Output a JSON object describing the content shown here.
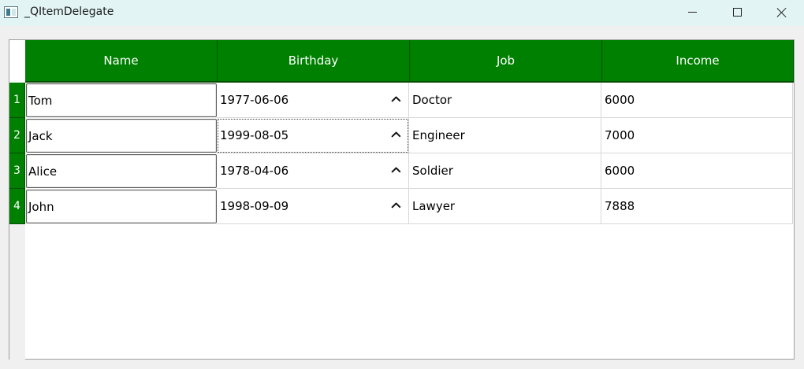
{
  "window": {
    "title": "_QItemDelegate"
  },
  "table": {
    "columns": [
      "Name",
      "Birthday",
      "Job",
      "Income"
    ],
    "row_numbers": [
      "1",
      "2",
      "3",
      "4"
    ],
    "rows": [
      {
        "name": "Tom",
        "birthday": "1977-06-06",
        "job": "Doctor",
        "income": "6000"
      },
      {
        "name": "Jack",
        "birthday": "1999-08-05",
        "job": "Engineer",
        "income": "7000"
      },
      {
        "name": "Alice",
        "birthday": "1978-04-06",
        "job": "Soldier",
        "income": "6000"
      },
      {
        "name": "John",
        "birthday": "1998-09-09",
        "job": "Lawyer",
        "income": "7888"
      }
    ]
  },
  "colors": {
    "header_bg": "#008000",
    "header_text": "#ffffff",
    "titlebar_bg": "#e3f4f4"
  }
}
